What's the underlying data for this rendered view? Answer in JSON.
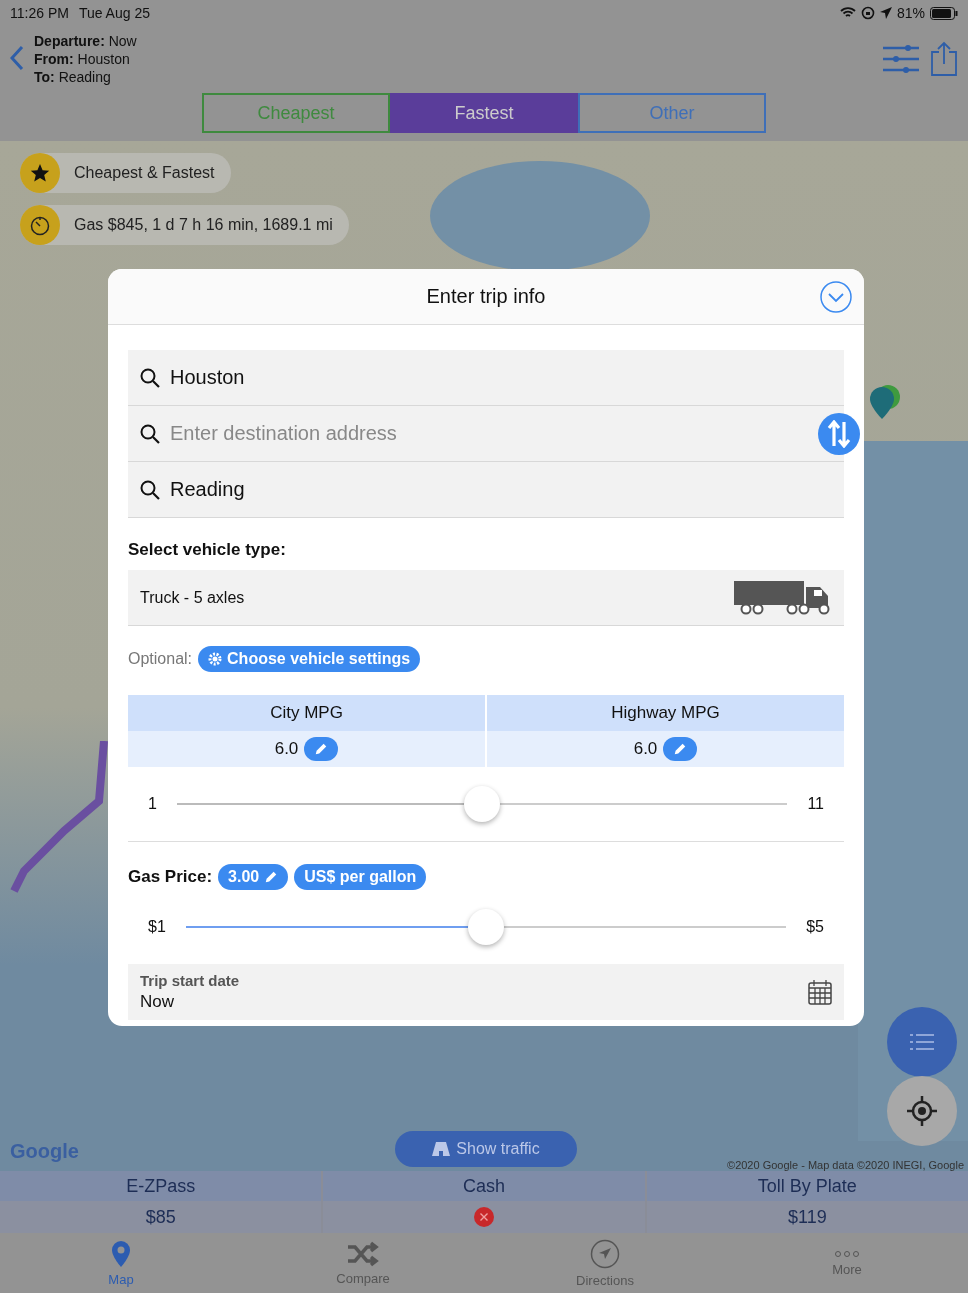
{
  "status_bar": {
    "time": "11:26 PM",
    "date": "Tue Aug 25",
    "battery": "81%"
  },
  "header": {
    "lines": [
      {
        "label": "Departure:",
        "value": "Now"
      },
      {
        "label": "From:",
        "value": "Houston"
      },
      {
        "label": "To:",
        "value": "Reading"
      }
    ]
  },
  "route_tabs": [
    {
      "label": "Cheapest",
      "color": "#3f8a3f",
      "selected": false
    },
    {
      "label": "Fastest",
      "color": "#5a3d9a",
      "selected": true
    },
    {
      "label": "Other",
      "color": "#3f6fb8",
      "selected": false
    }
  ],
  "map": {
    "chips": [
      {
        "kind": "star",
        "text": "Cheapest & Fastest"
      },
      {
        "kind": "timer",
        "text": "Gas $845, 1 d 7 h 16 min, 1689.1 mi"
      }
    ],
    "logo": "Google",
    "attribution": "©2020 Google - Map data ©2020 INEGI, Google",
    "traffic_button": "Show traffic"
  },
  "dialog": {
    "title": "Enter trip info",
    "fields": [
      {
        "value": "Houston"
      },
      {
        "placeholder": "Enter destination address"
      },
      {
        "value": "Reading"
      }
    ],
    "vehicle_heading": "Select vehicle type:",
    "vehicle": "Truck - 5 axles",
    "optional_label": "Optional:",
    "settings_button": "Choose vehicle settings",
    "mpg_columns": [
      {
        "header": "City MPG",
        "value": "6.0"
      },
      {
        "header": "Highway MPG",
        "value": "6.0"
      }
    ],
    "mpg_slider": {
      "min": "1",
      "max": "11",
      "level": 0.5
    },
    "gas_label": "Gas Price:",
    "gas_value": "3.00",
    "gas_unit": "US$ per gallon",
    "gas_slider": {
      "min": "$1",
      "max": "$5",
      "level": 0.5
    },
    "date_label": "Trip start date",
    "date_value": "Now"
  },
  "tolls": [
    {
      "name": "E-ZPass",
      "available": true,
      "price": "$85"
    },
    {
      "name": "Cash",
      "available": false
    },
    {
      "name": "Toll By Plate",
      "available": true,
      "price": "$119"
    }
  ],
  "tab_bar": [
    {
      "label": "Map",
      "kind": "pin",
      "selected": true
    },
    {
      "label": "Compare",
      "kind": "shuffle",
      "selected": false
    },
    {
      "label": "Directions",
      "kind": "compass",
      "selected": false
    },
    {
      "label": "More",
      "kind": "dots",
      "selected": false
    }
  ]
}
